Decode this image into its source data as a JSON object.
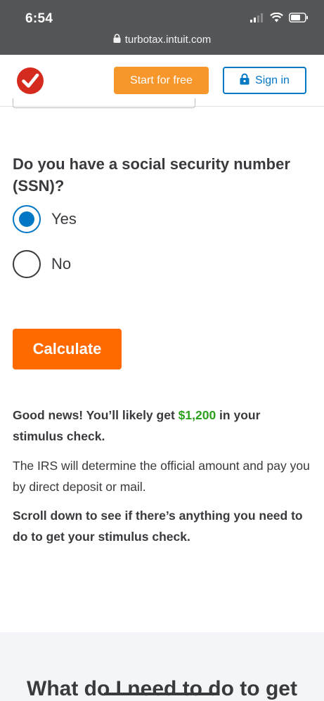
{
  "status_bar": {
    "time": "6:54",
    "url": "turbotax.intuit.com"
  },
  "header": {
    "start_label": "Start for free",
    "signin_label": "Sign in"
  },
  "question": {
    "text": "Do you have a social security number (SSN)?",
    "options": [
      {
        "label": "Yes",
        "selected": true
      },
      {
        "label": "No",
        "selected": false
      }
    ]
  },
  "calculate_label": "Calculate",
  "result": {
    "line1_pre": "Good news! You’ll likely get ",
    "amount": "$1,200",
    "line1_post": " in your stimulus check.",
    "irs_text": "The IRS will determine the official amount and pay you by direct deposit or mail.",
    "scroll_text": "Scroll down to see if there’s anything you need to do to get your stimulus check."
  },
  "next_section_heading": "What do I need to do to get",
  "colors": {
    "accent_blue": "#0077c5",
    "orange_button": "#ff6a00",
    "start_button": "#f7962b",
    "money_green": "#2ca01c",
    "logo_red": "#d52b1e"
  },
  "icons": [
    "signal-icon",
    "wifi-icon",
    "battery-icon",
    "lock-icon",
    "turbotax-logo",
    "padlock-icon"
  ]
}
